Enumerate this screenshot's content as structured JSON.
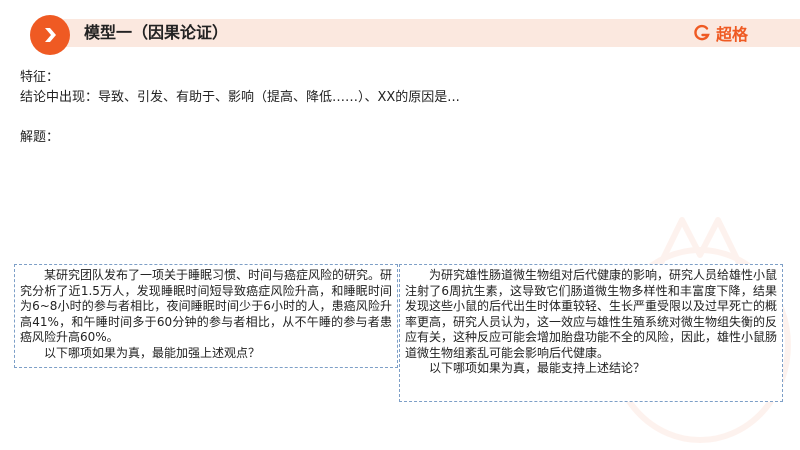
{
  "header": {
    "title": "模型一（因果论证）",
    "brand_name": "超格",
    "accent_color": "#ef5a23",
    "bar_color": "#fbe8df",
    "badge_icon": "chevron-right-icon",
    "brand_icon": "brand-logo-icon"
  },
  "content": {
    "features_label": "特征：",
    "features_text": "结论中出现：导致、引发、有助于、影响（提高、降低……）、XX的原因是...",
    "solution_label": "解题："
  },
  "questions": {
    "left": {
      "passage": "某研究团队发布了一项关于睡眠习惯、时间与癌症风险的研究。研究分析了近1.5万人，发现睡眠时间短导致癌症风险升高，和睡眠时间为6~8小时的参与者相比，夜间睡眠时间少于6小时的人，患癌风险升高41%，和午睡时间多于60分钟的参与者相比，从不午睡的参与者患癌风险升高60%。",
      "question": "以下哪项如果为真，最能加强上述观点？"
    },
    "right": {
      "passage": "为研究雄性肠道微生物组对后代健康的影响，研究人员给雄性小鼠注射了6周抗生素，这导致它们肠道微生物多样性和丰富度下降，结果发现这些小鼠的后代出生时体重较轻、生长严重受限以及过早死亡的概率更高，研究人员认为，这一效应与雄性生殖系统对微生物组失衡的反应有关，这种反应可能会增加胎盘功能不全的风险，因此，雄性小鼠肠道微生物组紊乱可能会影响后代健康。",
      "question": "以下哪项如果为真，最能支持上述结论？"
    }
  }
}
